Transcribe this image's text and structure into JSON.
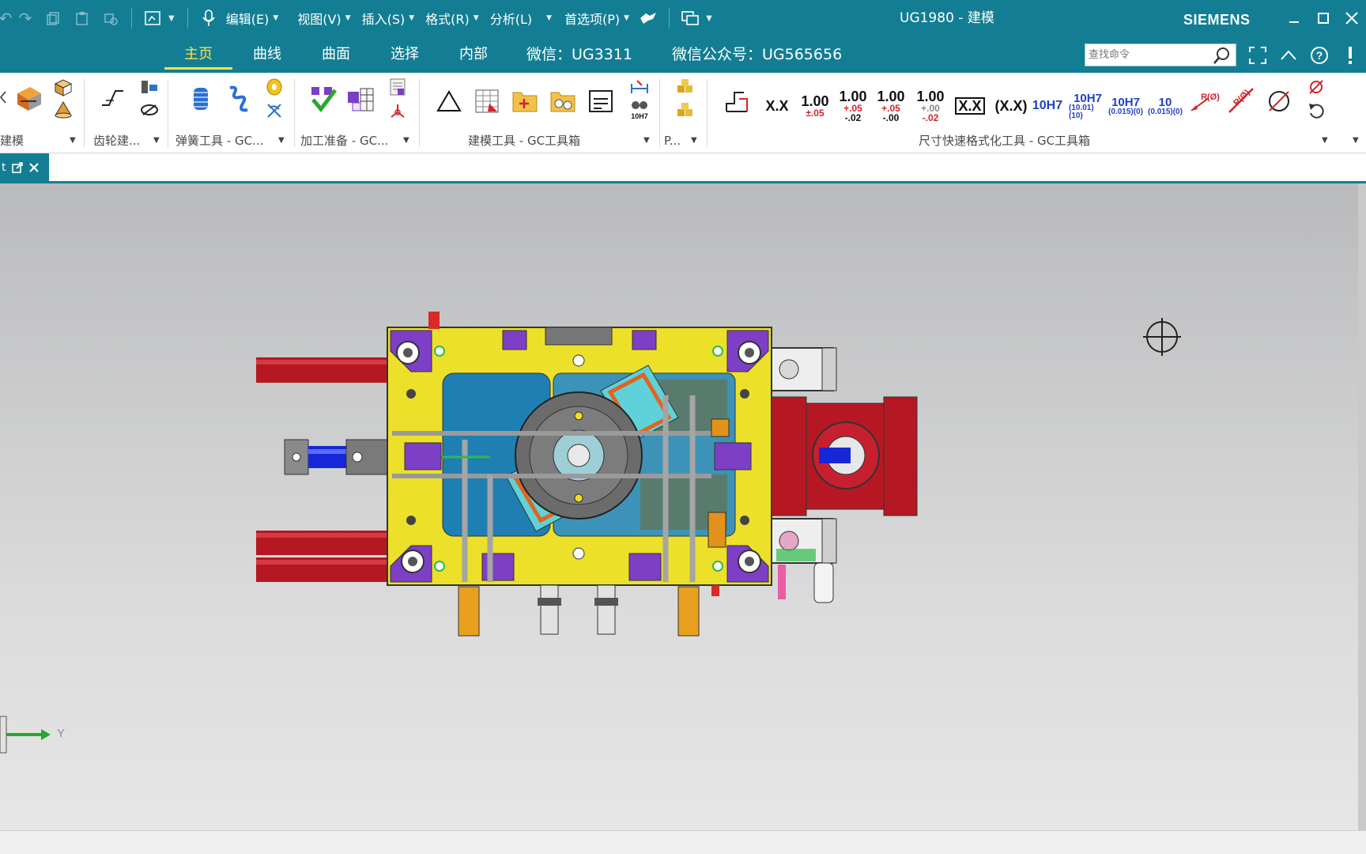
{
  "titlebar": {
    "menus": [
      {
        "label": "编辑(E)"
      },
      {
        "label": "视图(V)"
      },
      {
        "label": "插入(S)"
      },
      {
        "label": "格式(R)"
      },
      {
        "label": "分析(L)"
      },
      {
        "label": "首选项(P)"
      }
    ],
    "title": "UG1980 - 建模",
    "brand": "SIEMENS"
  },
  "tabs": [
    {
      "label": "主页",
      "active": true
    },
    {
      "label": "曲线"
    },
    {
      "label": "曲面"
    },
    {
      "label": "选择"
    },
    {
      "label": "内部"
    }
  ],
  "info": {
    "wechat": "微信：UG3311",
    "public_account": "微信公众号：UG565656"
  },
  "search": {
    "placeholder": "查找命令"
  },
  "ribbon": {
    "groups": [
      {
        "label": "建模"
      },
      {
        "label": "齿轮建..."
      },
      {
        "label": "弹簧工具 - GC..."
      },
      {
        "label": "加工准备 - GC..."
      },
      {
        "label": "建模工具 - GC工具箱"
      },
      {
        "label": "P..."
      },
      {
        "label": "尺寸快速格式化工具 - GC工具箱"
      }
    ],
    "dim_buttons": {
      "xx": "X.X",
      "tol1_main": "1.00",
      "tol1_sub": "±.05",
      "tol2_main": "1.00",
      "tol2_a": "+.05",
      "tol2_b": "-.02",
      "tol3_main": "1.00",
      "tol3_a": "+.05",
      "tol3_b": "-.00",
      "tol4_main": "1.00",
      "tol4_a": "+.00",
      "tol4_b": "-.02",
      "boxed": "X.X",
      "paren": "(X.X)",
      "fit": "10H7",
      "fit2_main": "10H7",
      "fit2_sub": "(10.01)(10)",
      "fit3_main": "10H7",
      "fit3_sub": "(0.015)(0)",
      "fit4_main": "10",
      "fit4_sub": "(0.015)(0)",
      "radius1": "R(Ø)",
      "radius2": "R(Ø)",
      "mini_fit": "10H7"
    }
  },
  "viewport": {
    "axis_label": "Y",
    "accent": "#137e93"
  }
}
